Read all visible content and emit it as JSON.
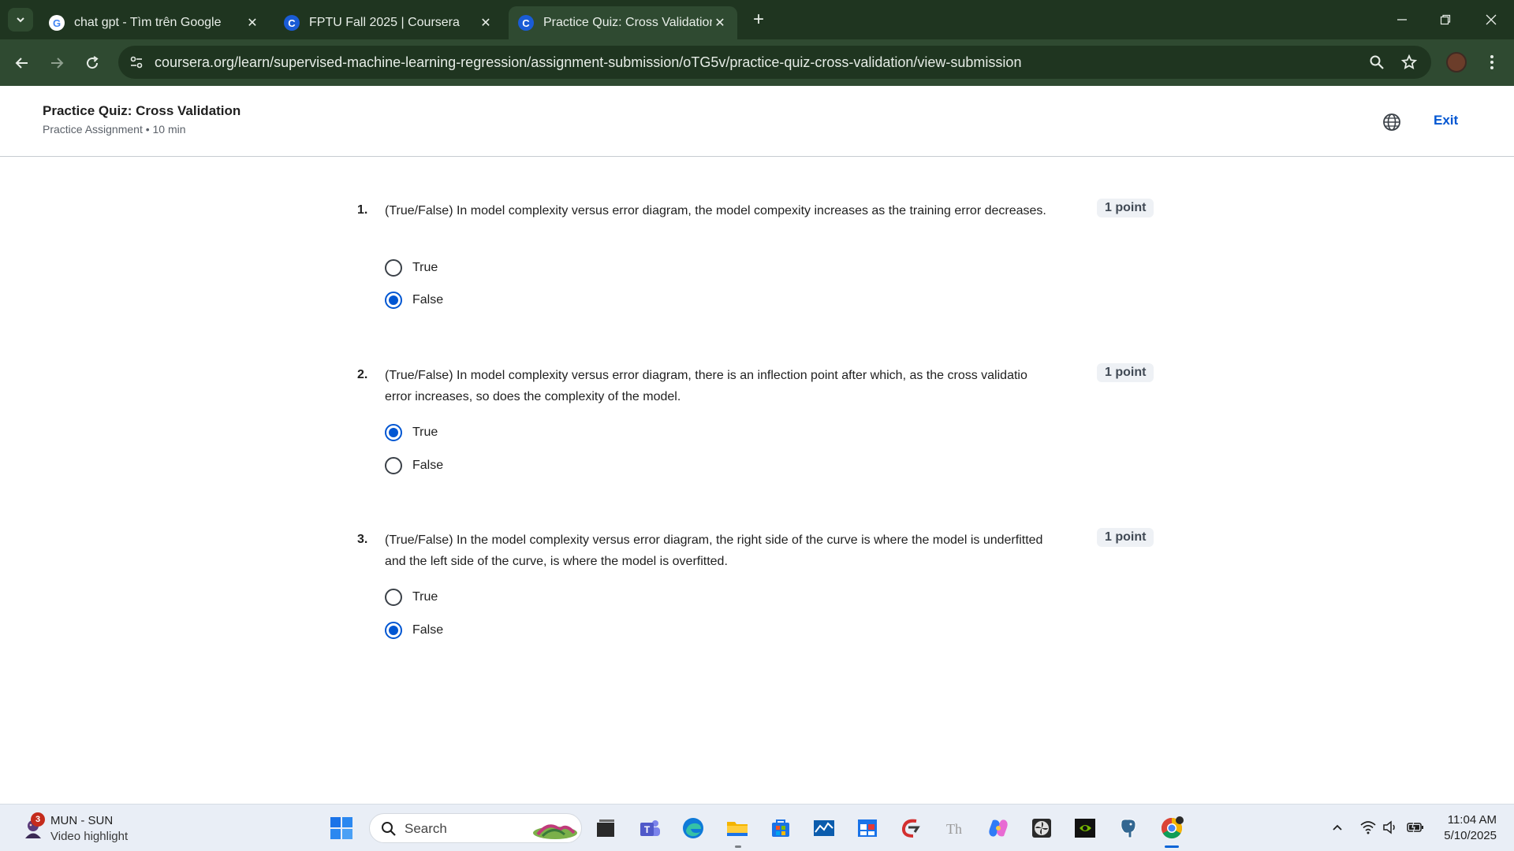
{
  "browser": {
    "tabs": [
      {
        "title": "chat gpt - Tìm trên Google",
        "favicon": "google-g-icon",
        "active": false
      },
      {
        "title": "FPTU Fall 2025 | Coursera",
        "favicon": "coursera-c-icon",
        "active": false
      },
      {
        "title": "Practice Quiz: Cross Validation |",
        "favicon": "coursera-c-icon",
        "active": true
      }
    ],
    "url": "coursera.org/learn/supervised-machine-learning-regression/assignment-submission/oTG5v/practice-quiz-cross-validation/view-submission",
    "theme_colors": {
      "tabbar": "#1f3520",
      "toolbar": "#2f4a31"
    }
  },
  "header": {
    "title": "Practice Quiz: Cross Validation",
    "subtitle": "Practice Assignment • 10 min",
    "exit_label": "Exit"
  },
  "questions": [
    {
      "number": "1.",
      "text": "(True/False) In model complexity versus error diagram, the model compexity increases as the training error decreases.",
      "points": "1 point",
      "options": [
        {
          "label": "True",
          "selected": false
        },
        {
          "label": "False",
          "selected": true
        }
      ]
    },
    {
      "number": "2.",
      "text": "(True/False) In model complexity versus error diagram, there is an inflection point after which, as the cross validatio error increases, so does  the complexity of the model.",
      "points": "1 point",
      "options": [
        {
          "label": "True",
          "selected": true
        },
        {
          "label": "False",
          "selected": false
        }
      ]
    },
    {
      "number": "3.",
      "text": "(True/False) In the model complexity versus error diagram, the right side of the curve is where the model is underfitted and the left side of the curve, is where the model is overfitted.",
      "points": "1 point",
      "options": [
        {
          "label": "True",
          "selected": false
        },
        {
          "label": "False",
          "selected": true
        }
      ]
    }
  ],
  "taskbar": {
    "widget": {
      "badge": "3",
      "title": "MUN - SUN",
      "subtitle": "Video highlight"
    },
    "search_label": "Search",
    "clock": {
      "time": "11:04 AM",
      "date": "5/10/2025"
    }
  },
  "accent_color": "#0056d2"
}
